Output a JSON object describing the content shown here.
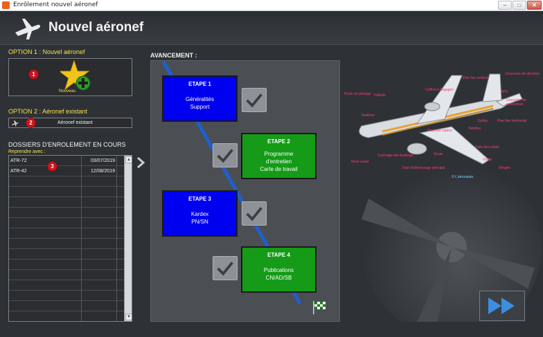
{
  "window": {
    "title": "Enrôlement nouvel aéronef",
    "buttons": {
      "minimize": "–",
      "maximize": "□",
      "close": "✕"
    }
  },
  "header": {
    "title": "Nouvel aéronef",
    "icon": "airplane-icon"
  },
  "option1": {
    "title": "OPTION 1 : Nouvel aéronef",
    "button_label": "Nouveau",
    "badge": "1"
  },
  "option2": {
    "title": "OPTION 2 : Aéronef existant",
    "button_label": "Aéronef existant",
    "badge": "2"
  },
  "dossiers": {
    "title": "DOSSIERS D'ENROLEMENT EN COURS",
    "subtitle": "Reprendre avec :",
    "badge": "3",
    "rows": [
      {
        "aircraft": "ATR-72",
        "date": "03/07/2019"
      },
      {
        "aircraft": "ATR-42",
        "date": "12/08/2019"
      }
    ]
  },
  "progress": {
    "title": "AVANCEMENT :",
    "steps": [
      {
        "title": "ETAPE 1",
        "lines": [
          "Généralités",
          "Support"
        ],
        "color": "#0000f0"
      },
      {
        "title": "ETAPE 2",
        "lines": [
          "Programme",
          "d'entretien",
          "Carte de travail"
        ],
        "color": "#159b17"
      },
      {
        "title": "ETAPE 3",
        "lines": [
          "Kardex",
          "PN/SN"
        ],
        "color": "#0000f0"
      },
      {
        "title": "ETAPE 4",
        "lines": [
          "Publications",
          "CN/AD/SB"
        ],
        "color": "#159b17"
      }
    ]
  },
  "illustration": {
    "copyright": "© L'aéronaute",
    "callouts": [
      "Gouverne de direction",
      "Plan fixe vertical",
      "APU",
      "Gouverne de profondeur",
      "Plan fixe horizontal",
      "Galley",
      "Toilettes",
      "Coffres à bagages",
      "Hublots",
      "Poste de pilotage",
      "Radôme",
      "Nose avant",
      "Carénage aile-fuselage",
      "Plancher cabine",
      "Soute",
      "Train d'atterrissage principal",
      "Volets",
      "Ailerons",
      "Becs",
      "Winglet",
      "Rails des volets"
    ]
  },
  "colors": {
    "accent": "#f6e24a",
    "step_blue": "#0000f0",
    "step_green": "#159b17",
    "badge_red": "#c8161d",
    "track_blue": "#1f5fd0"
  }
}
